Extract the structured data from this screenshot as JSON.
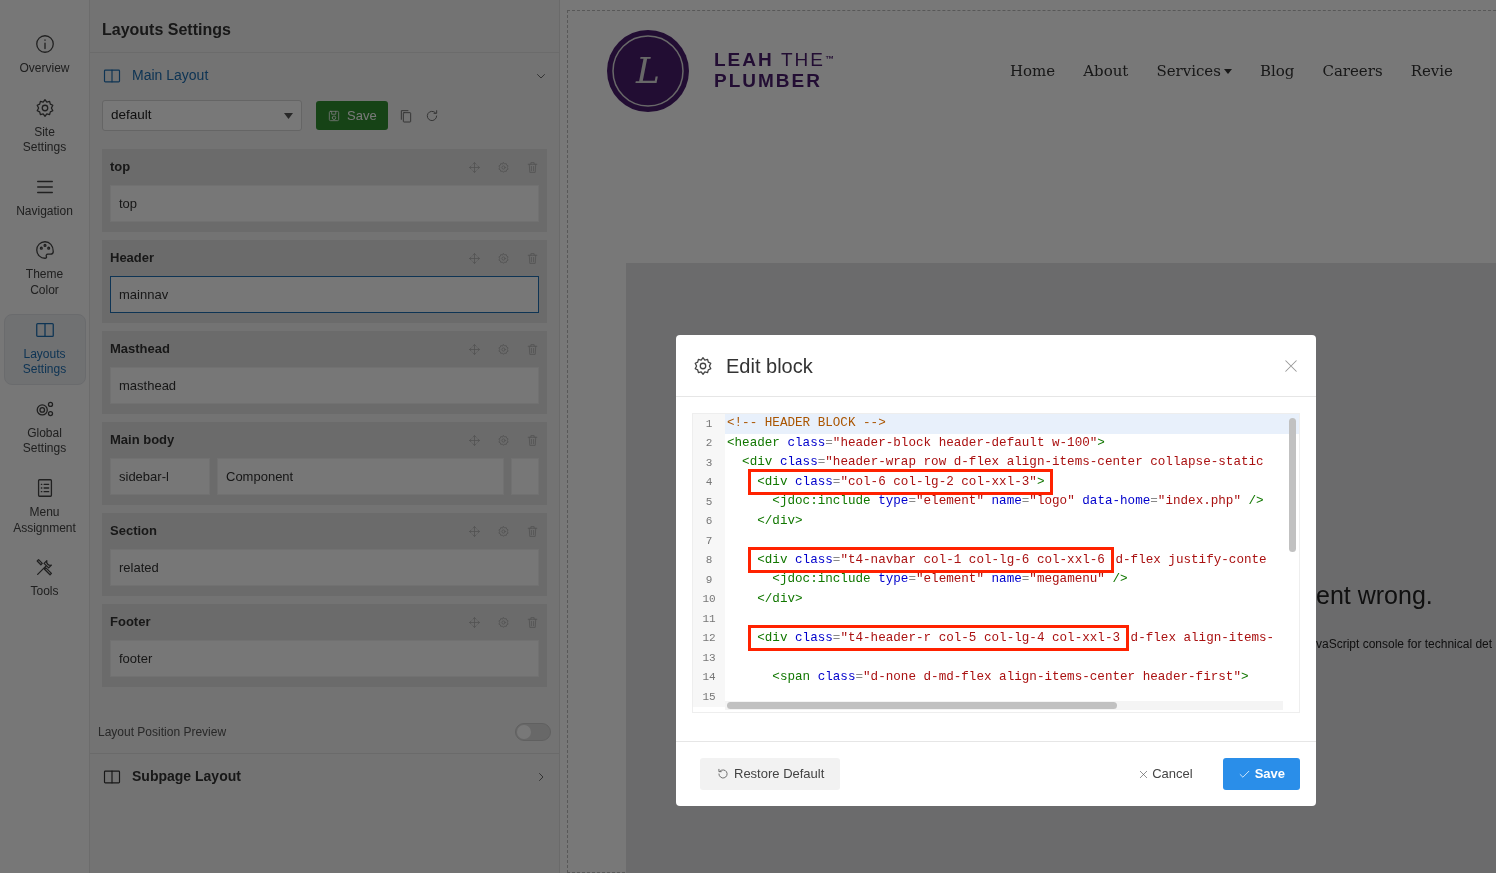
{
  "sidebar": {
    "items": [
      {
        "label": "Overview",
        "selected": false
      },
      {
        "label": "Site Settings",
        "selected": false
      },
      {
        "label": "Navigation",
        "selected": false
      },
      {
        "label": "Theme Color",
        "selected": false
      },
      {
        "label": "Layouts Settings",
        "selected": true
      },
      {
        "label": "Global Settings",
        "selected": false
      },
      {
        "label": "Menu Assignment",
        "selected": false
      },
      {
        "label": "Tools",
        "selected": false
      }
    ]
  },
  "panel": {
    "title": "Layouts Settings",
    "main_layout": {
      "title": "Main Layout",
      "expanded": true,
      "layout_select": "default",
      "save_button": "Save",
      "sections": [
        {
          "title": "top",
          "positions": [
            {
              "kind": "position",
              "label": "top",
              "selected": false
            }
          ]
        },
        {
          "title": "Header",
          "positions": [
            {
              "kind": "position",
              "label": "mainnav",
              "selected": true
            }
          ]
        },
        {
          "title": "Masthead",
          "positions": [
            {
              "kind": "position",
              "label": "masthead",
              "selected": false
            }
          ]
        },
        {
          "title": "Main body",
          "positions": [
            {
              "kind": "position",
              "label": "sidebar-l",
              "selected": false
            },
            {
              "kind": "position",
              "label": "Component",
              "selected": false
            },
            {
              "kind": "blank",
              "selected": false
            }
          ]
        },
        {
          "title": "Section",
          "positions": [
            {
              "kind": "position",
              "label": "related",
              "selected": false
            }
          ]
        },
        {
          "title": "Footer",
          "positions": [
            {
              "kind": "position",
              "label": "footer",
              "selected": false
            }
          ]
        }
      ]
    },
    "preview_toggle": {
      "label": "Layout Position Preview",
      "on": false
    },
    "subpage_layout": {
      "title": "Subpage Layout",
      "expanded": false
    }
  },
  "preview": {
    "logo": {
      "line_1": "LEAH THE",
      "trademark": "™",
      "line_2": "PLUMBER",
      "initial": "L"
    },
    "nav": [
      {
        "label": "Home"
      },
      {
        "label": "About"
      },
      {
        "label": "Services",
        "dropdown": true
      },
      {
        "label": "Blog"
      },
      {
        "label": "Careers"
      },
      {
        "label": "Revie"
      }
    ],
    "error": {
      "heading": "ent wrong.",
      "message": "vaScript console for technical det"
    }
  },
  "modal": {
    "title": "Edit block",
    "lines": [
      {
        "number": "1",
        "active": true,
        "tokens": [
          {
            "kind": "comment",
            "text": "<!-- HEADER BLOCK -->"
          }
        ]
      },
      {
        "number": "2",
        "tokens": [
          {
            "kind": "tag",
            "text": "<header"
          },
          {
            "kind": "attr",
            "text": " class"
          },
          {
            "kind": "punct",
            "text": "="
          },
          {
            "kind": "string",
            "text": "\"header-block header-default w-100\""
          },
          {
            "kind": "tag",
            "text": ">"
          }
        ]
      },
      {
        "number": "3",
        "tokens": [
          {
            "kind": "tag",
            "text": "  <div"
          },
          {
            "kind": "attr",
            "text": " class"
          },
          {
            "kind": "punct",
            "text": "="
          },
          {
            "kind": "string",
            "text": "\"header-wrap row d-flex align-items-center collapse-static"
          }
        ]
      },
      {
        "number": "4",
        "tokens": [
          {
            "kind": "tag",
            "text": "    <div",
            "boxed": true
          },
          {
            "kind": "attr",
            "text": " class",
            "boxed": true
          },
          {
            "kind": "punct",
            "text": "=",
            "boxed": true
          },
          {
            "kind": "string",
            "text": "\"col-6 col-lg-2 col-xxl-3\"",
            "boxed": true
          },
          {
            "kind": "tag",
            "text": ">",
            "boxed": true
          }
        ]
      },
      {
        "number": "5",
        "tokens": [
          {
            "kind": "tag",
            "text": "      <jdoc:include"
          },
          {
            "kind": "attr",
            "text": " type"
          },
          {
            "kind": "punct",
            "text": "="
          },
          {
            "kind": "string",
            "text": "\"element\""
          },
          {
            "kind": "attr",
            "text": " name"
          },
          {
            "kind": "punct",
            "text": "="
          },
          {
            "kind": "string",
            "text": "\"logo\""
          },
          {
            "kind": "attr",
            "text": " data-home"
          },
          {
            "kind": "punct",
            "text": "="
          },
          {
            "kind": "string",
            "text": "\"index.php\""
          },
          {
            "kind": "tag",
            "text": " />"
          }
        ]
      },
      {
        "number": "6",
        "tokens": [
          {
            "kind": "tag",
            "text": "    </div>"
          }
        ]
      },
      {
        "number": "7"
      },
      {
        "number": "8",
        "tokens": [
          {
            "kind": "tag",
            "text": "    <div",
            "boxed": true
          },
          {
            "kind": "attr",
            "text": " class",
            "boxed": true
          },
          {
            "kind": "punct",
            "text": "=",
            "boxed": true
          },
          {
            "kind": "string",
            "text": "\"t4-navbar col-1 col-lg-6 col-xxl-6",
            "boxed": true
          },
          {
            "kind": "string",
            "text": " d-flex justify-conte"
          }
        ]
      },
      {
        "number": "9",
        "tokens": [
          {
            "kind": "tag",
            "text": "      <jdoc:include"
          },
          {
            "kind": "attr",
            "text": " type"
          },
          {
            "kind": "punct",
            "text": "="
          },
          {
            "kind": "string",
            "text": "\"element\""
          },
          {
            "kind": "attr",
            "text": " name"
          },
          {
            "kind": "punct",
            "text": "="
          },
          {
            "kind": "string",
            "text": "\"megamenu\""
          },
          {
            "kind": "tag",
            "text": " />"
          }
        ]
      },
      {
        "number": "10",
        "tokens": [
          {
            "kind": "tag",
            "text": "    </div>"
          }
        ]
      },
      {
        "number": "11"
      },
      {
        "number": "12",
        "tokens": [
          {
            "kind": "tag",
            "text": "    <div",
            "boxed": true
          },
          {
            "kind": "attr",
            "text": " class",
            "boxed": true
          },
          {
            "kind": "punct",
            "text": "=",
            "boxed": true
          },
          {
            "kind": "string",
            "text": "\"t4-header-r col-5 col-lg-4 col-xxl-3",
            "boxed": true
          },
          {
            "kind": "string",
            "text": " d-flex align-items-"
          }
        ]
      },
      {
        "number": "13"
      },
      {
        "number": "14",
        "tokens": [
          {
            "kind": "tag",
            "text": "      <span"
          },
          {
            "kind": "attr",
            "text": " class"
          },
          {
            "kind": "punct",
            "text": "="
          },
          {
            "kind": "string",
            "text": "\"d-none d-md-flex align-items-center header-first\""
          },
          {
            "kind": "tag",
            "text": ">"
          }
        ]
      },
      {
        "number": "15"
      }
    ],
    "restore_button": "Restore Default",
    "cancel_button": "Cancel",
    "save_button": "Save"
  }
}
